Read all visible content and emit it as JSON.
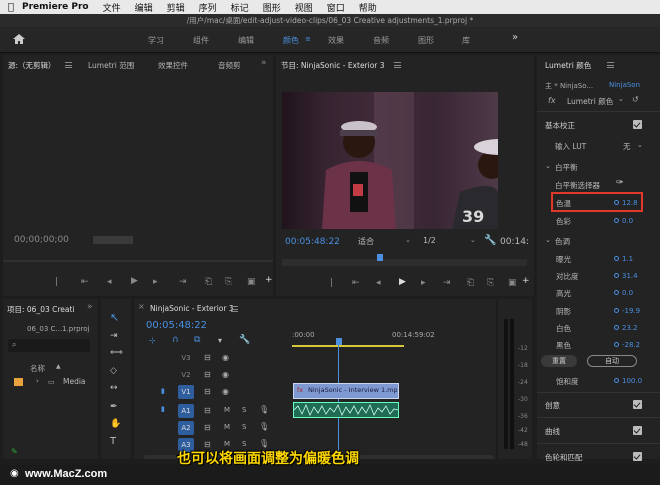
{
  "menubar": {
    "app": "Premiere Pro",
    "items": [
      "文件",
      "编辑",
      "剪辑",
      "序列",
      "标记",
      "图形",
      "视图",
      "窗口",
      "帮助"
    ]
  },
  "path_title": "/用户/mac/桌面/edit-adjust-video-clips/06_03 Creative adjustments_1.prproj *",
  "workspaces": {
    "tabs": [
      "学习",
      "组件",
      "编辑",
      "颜色",
      "效果",
      "音频",
      "图形",
      "库"
    ],
    "active": "颜色"
  },
  "source_panel": {
    "tabs": [
      "源:（无剪辑）",
      "Lumetri 范围",
      "效果控件",
      "音频剪"
    ],
    "timecode": "00;00;00;00"
  },
  "program_panel": {
    "title": "节目: NinjaSonic - Exterior 3",
    "timecode": "00:05:48:22",
    "fit": "适合",
    "resolution": "1/2",
    "end_timecode": "00:14:"
  },
  "project_panel": {
    "title": "项目: 06_03 Creati",
    "file": "06_03 C...1.prproj",
    "col_name": "名称",
    "bin": "Media"
  },
  "timeline": {
    "title": "NinjaSonic - Exterior 3",
    "timecode": "00:05:48:22",
    "ruler_start": ":00:00",
    "ruler_mid": "00:14:59:02",
    "video_tracks": [
      "V3",
      "V2",
      "V1"
    ],
    "audio_tracks": [
      "A1",
      "A2",
      "A3"
    ],
    "clip_v1": "NinjaSonic - Interview 1.mp",
    "meter_labels": [
      "-12",
      "-18",
      "-24",
      "-30",
      "-36",
      "-42",
      "-48"
    ]
  },
  "lumetri": {
    "title": "Lumetri 颜色",
    "master": "主 * NinjaSo...",
    "clip": "NinjaSon",
    "effect": "Lumetri 颜色",
    "basic": "基本校正",
    "lut_label": "输入 LUT",
    "lut_value": "无",
    "white_balance": "白平衡",
    "wb_selector": "白平衡选择器",
    "temp_label": "色温",
    "temp_value": "12.8",
    "tint_label": "色彩",
    "tint_value": "0.0",
    "tone": "色调",
    "rows": [
      {
        "label": "曝光",
        "value": "1.1"
      },
      {
        "label": "对比度",
        "value": "31.4"
      },
      {
        "label": "高光",
        "value": "0.0"
      },
      {
        "label": "阴影",
        "value": "-19.9"
      },
      {
        "label": "白色",
        "value": "23.2"
      },
      {
        "label": "黑色",
        "value": "-28.2"
      }
    ],
    "reset": "重置",
    "auto": "自动",
    "saturation_label": "饱和度",
    "saturation_value": "100.0",
    "sections": [
      "创意",
      "曲线",
      "色轮和匹配"
    ]
  },
  "subtitle": "也可以将画面调整为偏暖色调",
  "watermark": "www.MacZ.com",
  "colors": {
    "accent": "#4a8fe0",
    "highlight_box": "#e0392b",
    "subtitle": "#ffd800",
    "clip_audio": "#1f6b56",
    "clip_video": "#7f9ad3"
  }
}
